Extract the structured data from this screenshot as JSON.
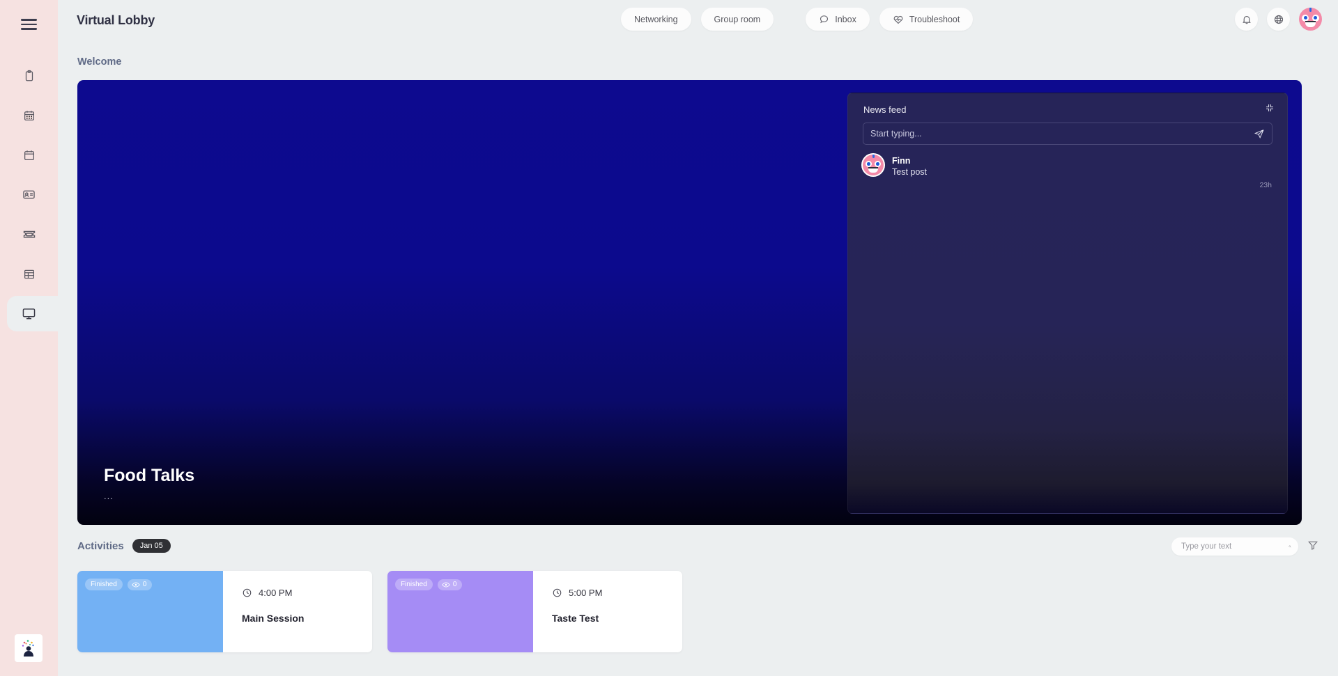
{
  "sidebar": {
    "menu_icon": "hamburger-icon",
    "items": [
      {
        "id": "clipboard",
        "icon": "clipboard-icon",
        "active": false
      },
      {
        "id": "calendar-grid",
        "icon": "calendar-grid-icon",
        "active": false
      },
      {
        "id": "calendar",
        "icon": "calendar-icon",
        "active": false
      },
      {
        "id": "id-card",
        "icon": "id-card-icon",
        "active": false
      },
      {
        "id": "ticket",
        "icon": "ticket-icon",
        "active": false
      },
      {
        "id": "table",
        "icon": "table-icon",
        "active": false
      },
      {
        "id": "virtual-lobby",
        "icon": "monitor-icon",
        "active": true
      }
    ],
    "brand_tile": "confetti-person-logo"
  },
  "topbar": {
    "title": "Virtual Lobby",
    "center_buttons": [
      {
        "label": "Networking",
        "icon": ""
      },
      {
        "label": "Group room",
        "icon": ""
      },
      {
        "label": "Inbox",
        "icon": "chat-bubble-icon"
      },
      {
        "label": "Troubleshoot",
        "icon": "heart-pulse-icon"
      }
    ],
    "right_icons": [
      {
        "name": "notifications-bell-icon"
      },
      {
        "name": "globe-language-icon"
      }
    ],
    "avatar": "user-avatar-monster"
  },
  "main": {
    "welcome_label": "Welcome",
    "hero": {
      "title": "Food Talks",
      "subtitle": "...",
      "gradient_top": "#0d0a8f",
      "gradient_bottom": "#02010f"
    },
    "newsfeed": {
      "title": "News feed",
      "collapse_icon": "collapse-icon",
      "input_placeholder": "Start typing...",
      "input_value": "",
      "send_icon": "send-paper-plane-icon",
      "posts": [
        {
          "author": "Finn",
          "text": "Test post",
          "time": "23h",
          "avatar": "monster-avatar"
        }
      ],
      "background": "#262458"
    }
  },
  "activities": {
    "title": "Activities",
    "date_badge": "Jan 05",
    "search_placeholder": "Type your text",
    "search_value": "",
    "search_icon": "search-icon",
    "filter_icon": "filter-funnel-icon",
    "cards": [
      {
        "status": "Finished",
        "views": "0",
        "time": "4:00 PM",
        "name": "Main Session",
        "color": "#73b1f4"
      },
      {
        "status": "Finished",
        "views": "0",
        "time": "5:00 PM",
        "name": "Taste Test",
        "color": "#a58cf5"
      }
    ]
  }
}
